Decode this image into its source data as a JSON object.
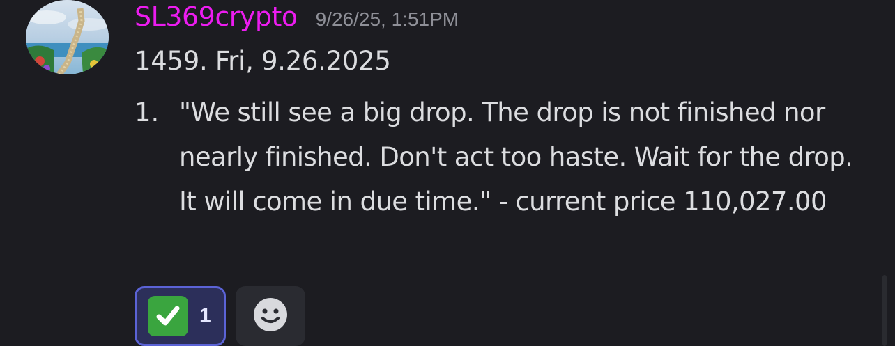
{
  "message": {
    "author": "SL369crypto",
    "timestamp": "9/26/25, 1:51PM",
    "title": "1459.  Fri, 9.26.2025",
    "list": [
      {
        "number": "1.",
        "text": "\"We still see a big drop. The drop is not finished nor nearly finished. Don't act too haste. Wait for the drop. It will come in due time.\" - current price 110,027.00"
      }
    ]
  },
  "reactions": [
    {
      "emoji": "white-check-mark-icon",
      "count": "1"
    }
  ],
  "add_reaction_icon": "smiley-face-icon",
  "colors": {
    "author": "#ec1cf0",
    "background": "#1c1c21",
    "reaction_active_border": "#5b63d6",
    "reaction_active_bg": "#2c2f5a"
  }
}
